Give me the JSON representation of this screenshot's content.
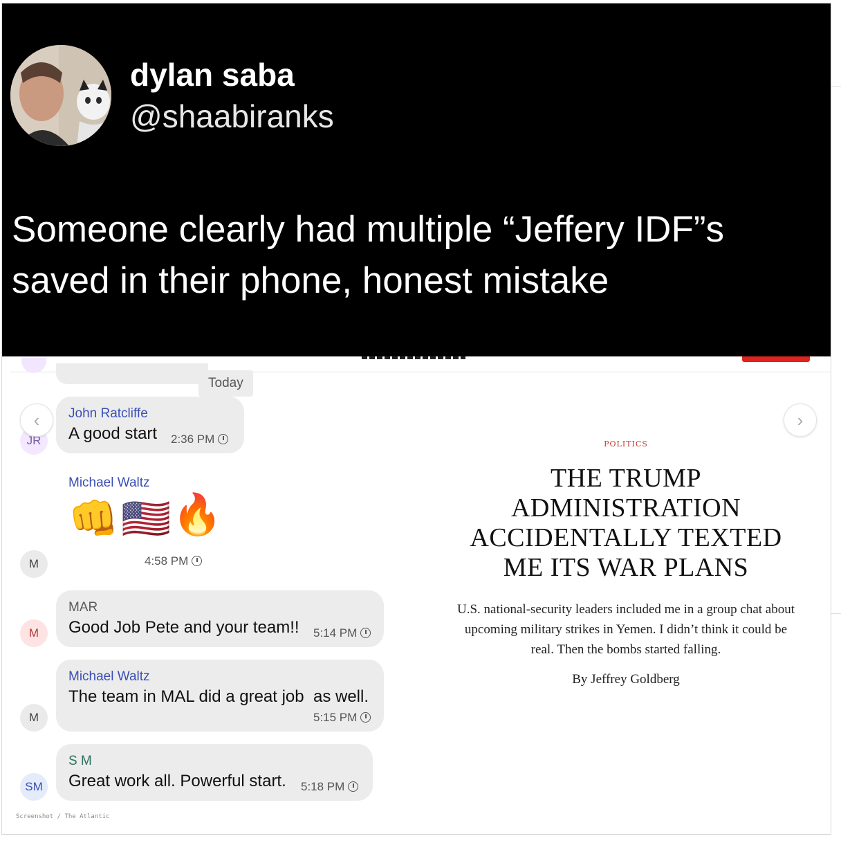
{
  "tweet": {
    "display_name": "dylan saba",
    "handle": "@shaabiranks",
    "text": "Someone clearly had multiple “Jeffery IDF”s saved in their phone, honest mistake"
  },
  "chat": {
    "date_divider": "Today",
    "messages": [
      {
        "avatar": "JR",
        "sender": "John Ratcliffe",
        "text": "A good start",
        "time": "2:36 PM"
      },
      {
        "avatar": "M",
        "sender": "Michael Waltz",
        "emojis": [
          "👊",
          "🇺🇸",
          "🔥"
        ],
        "time": "4:58 PM"
      },
      {
        "avatar": "M",
        "sender": "MAR",
        "text": "Good Job Pete and your team!!",
        "time": "5:14 PM"
      },
      {
        "avatar": "M",
        "sender": "Michael Waltz",
        "text": "The team in MAL did a great job  as well.",
        "time": "5:15 PM"
      },
      {
        "avatar": "SM",
        "sender": "S M",
        "text": "Great work all. Powerful start.",
        "time": "5:18 PM"
      }
    ],
    "caption": "Screenshot / The Atlantic"
  },
  "article": {
    "kicker": "POLITICS",
    "headline": "THE TRUMP ADMINISTRATION ACCIDENTALLY TEXTED ME ITS WAR PLANS",
    "dek": "U.S. national-security leaders included me in a group chat about upcoming military strikes in Yemen. I didn’t think it could be real. Then the bombs started falling.",
    "byline": "By Jeffrey Goldberg"
  },
  "icons": {
    "prev": "chevron-left-icon",
    "next": "chevron-right-icon",
    "clock": "clock-icon"
  },
  "colors": {
    "tweet_bg": "#000000",
    "sender_blue": "#3a4eb5",
    "kicker_red": "#c0392b",
    "accent_red": "#e0231f"
  }
}
